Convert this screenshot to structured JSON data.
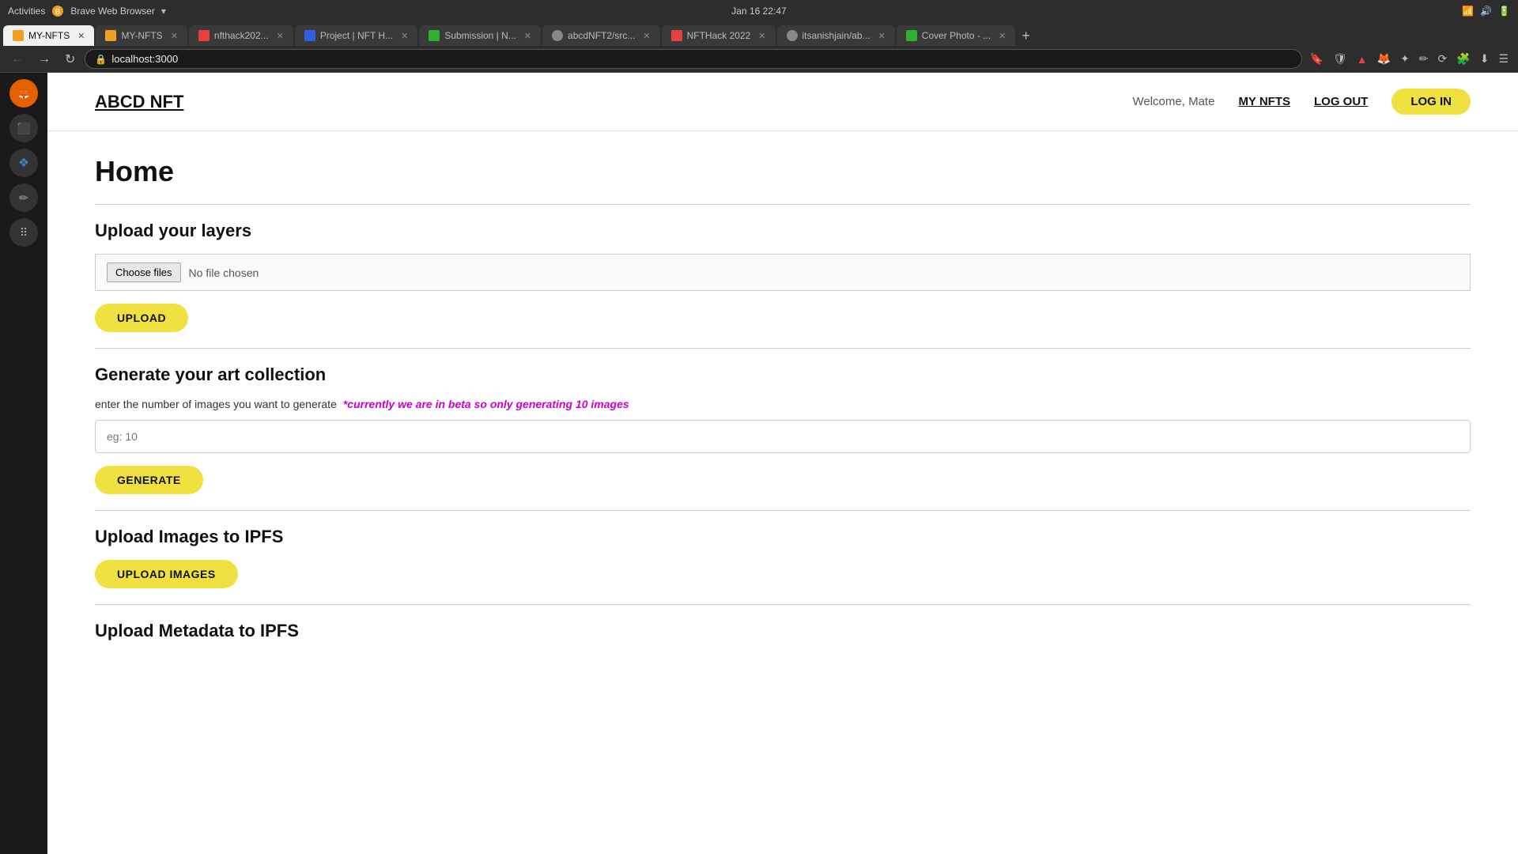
{
  "os_bar": {
    "activities": "Activities",
    "browser_name": "Brave Web Browser",
    "datetime": "Jan 16  22:47"
  },
  "tabs": [
    {
      "label": "MY-NFTS",
      "active": true,
      "icon_color": "#f0a020"
    },
    {
      "label": "MY-NFTS",
      "active": false,
      "icon_color": "#f0a020"
    },
    {
      "label": "nfthack202...",
      "active": false,
      "icon_color": "#e84040"
    },
    {
      "label": "Project | NFT H...",
      "active": false,
      "icon_color": "#3060e0"
    },
    {
      "label": "Submission | N...",
      "active": false,
      "icon_color": "#30b030"
    },
    {
      "label": "abcdNFT2/src...",
      "active": false,
      "icon_color": "#888"
    },
    {
      "label": "NFTHack 2022",
      "active": false,
      "icon_color": "#e84040"
    },
    {
      "label": "itsanishjain/ab...",
      "active": false,
      "icon_color": "#888"
    },
    {
      "label": "Cover Photo - ...",
      "active": false,
      "icon_color": "#30b030"
    }
  ],
  "address_bar": {
    "url": "localhost:3000"
  },
  "site": {
    "logo": "ABCD NFT",
    "welcome_text": "Welcome, Mate",
    "my_nfts_label": "MY NFTS",
    "logout_label": "LOG OUT",
    "login_label": "LOG IN"
  },
  "page": {
    "title": "Home",
    "sections": {
      "upload_layers": {
        "title": "Upload your layers",
        "choose_files_label": "Choose files",
        "no_file_text": "No file chosen",
        "upload_btn": "UPLOAD"
      },
      "generate": {
        "title": "Generate your art collection",
        "description": "enter the number of images you want to generate",
        "beta_notice": "*currently we are in beta so only generating 10 images",
        "input_placeholder": "eg: 10",
        "generate_btn": "GENERATE"
      },
      "upload_ipfs": {
        "title": "Upload Images to IPFS",
        "upload_btn": "UPLOAD IMAGES"
      },
      "upload_metadata": {
        "title": "Upload Metadata to IPFS"
      }
    }
  }
}
